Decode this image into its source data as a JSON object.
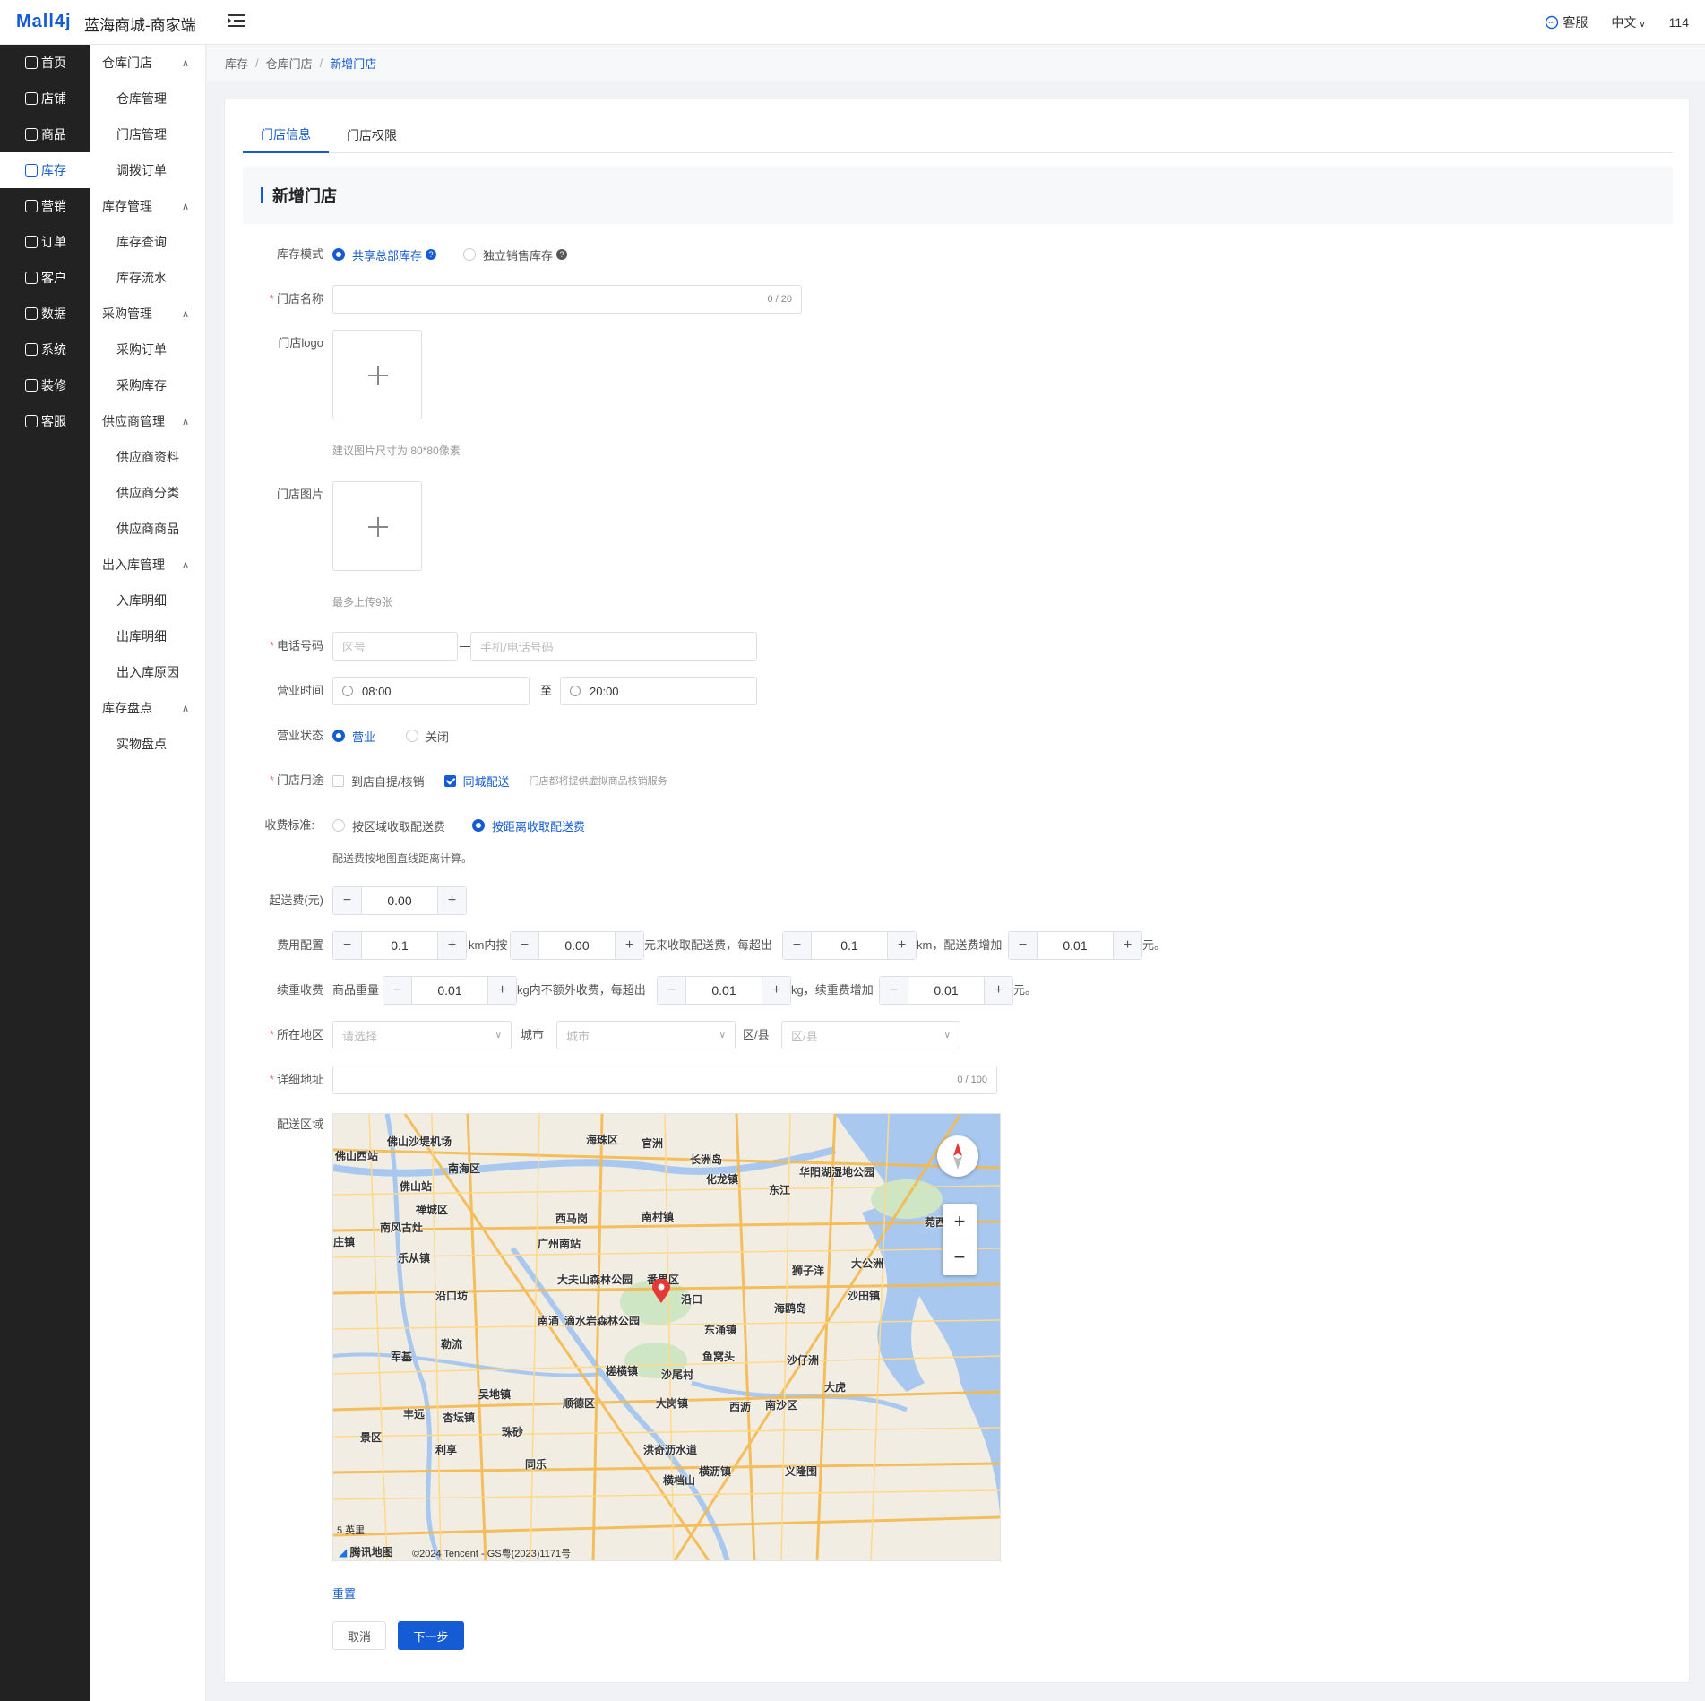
{
  "header": {
    "logo": "Mall4j",
    "store_name": "蓝海商城-商家端",
    "service": "客服",
    "language": "中文",
    "user": "114"
  },
  "nav": [
    {
      "label": "首页",
      "icon": "home-icon"
    },
    {
      "label": "店铺",
      "icon": "store-icon"
    },
    {
      "label": "商品",
      "icon": "product-icon"
    },
    {
      "label": "库存",
      "icon": "inventory-icon",
      "active": true
    },
    {
      "label": "营销",
      "icon": "gift-icon"
    },
    {
      "label": "订单",
      "icon": "order-icon"
    },
    {
      "label": "客户",
      "icon": "customer-icon"
    },
    {
      "label": "数据",
      "icon": "data-icon"
    },
    {
      "label": "系统",
      "icon": "settings-icon"
    },
    {
      "label": "装修",
      "icon": "decorate-icon"
    },
    {
      "label": "客服",
      "icon": "chat-icon"
    }
  ],
  "subnav": {
    "groups": [
      {
        "title": "仓库门店",
        "items": [
          "仓库管理",
          "门店管理",
          "调拨订单"
        ]
      },
      {
        "title": "库存管理",
        "items": [
          "库存查询",
          "库存流水"
        ]
      },
      {
        "title": "采购管理",
        "items": [
          "采购订单",
          "采购库存"
        ]
      },
      {
        "title": "供应商管理",
        "items": [
          "供应商资料",
          "供应商分类",
          "供应商商品"
        ]
      },
      {
        "title": "出入库管理",
        "items": [
          "入库明细",
          "出库明细",
          "出入库原因"
        ]
      },
      {
        "title": "库存盘点",
        "items": [
          "实物盘点"
        ]
      }
    ]
  },
  "breadcrumb": [
    "库存",
    "仓库门店",
    "新增门店"
  ],
  "tabs": [
    "门店信息",
    "门店权限"
  ],
  "section_title": "新增门店",
  "form": {
    "stock_mode": {
      "label": "库存模式",
      "options": [
        "共享总部库存",
        "独立销售库存"
      ],
      "selected": 0
    },
    "store_name": {
      "label": "门店名称",
      "counter": "0 / 20"
    },
    "store_logo": {
      "label": "门店logo",
      "hint": "建议图片尺寸为 80*80像素"
    },
    "store_images": {
      "label": "门店图片",
      "hint": "最多上传9张"
    },
    "phone": {
      "label": "电话号码",
      "area_placeholder": "区号",
      "dash": "—",
      "number_placeholder": "手机/电话号码"
    },
    "hours": {
      "label": "营业时间",
      "start": "08:00",
      "to": "至",
      "end": "20:00"
    },
    "status": {
      "label": "营业状态",
      "options": [
        "营业",
        "关闭"
      ],
      "selected": 0
    },
    "usage": {
      "label": "门店用途",
      "options": [
        "到店自提/核销",
        "同城配送"
      ],
      "checked": [
        false,
        true
      ],
      "note": "门店都将提供虚拟商品核销服务"
    },
    "fee_standard": {
      "label": "收费标准:",
      "options": [
        "按区域收取配送费",
        "按距离收取配送费"
      ],
      "selected": 1,
      "hint": "配送费按地图直线距离计算。"
    },
    "min_fee": {
      "label": "起送费(元)",
      "value": "0.00"
    },
    "fee_config": {
      "label": "费用配置",
      "v1": "0.1",
      "t1": "km内按",
      "v2": "0.00",
      "t2": "元来收取配送费，每超出",
      "v3": "0.1",
      "t3": "km，配送费增加",
      "v4": "0.01",
      "t4": "元。"
    },
    "weight_fee": {
      "label": "续重收费",
      "t0": "商品重量",
      "v1": "0.01",
      "t1": "kg内不额外收费，每超出",
      "v2": "0.01",
      "t2": "kg，续重费增加",
      "v3": "0.01",
      "t3": "元。"
    },
    "region": {
      "label": "所在地区",
      "province_placeholder": "请选择",
      "city_label": "城市",
      "city_placeholder": "城市",
      "district_label": "区/县",
      "district_placeholder": "区/县"
    },
    "address": {
      "label": "详细地址",
      "counter": "0 / 100"
    },
    "delivery_area": {
      "label": "配送区域"
    }
  },
  "map": {
    "labels": [
      "海珠区",
      "官洲",
      "长洲岛",
      "佛山沙堤机场",
      "佛山西站",
      "南海区",
      "化龙镇",
      "华阳湖湿地公园",
      "东江",
      "佛山站",
      "禅城区",
      "西马岗",
      "南村镇",
      "南风古灶",
      "广州南站",
      "庄镇",
      "乐从镇",
      "大夫山森林公园",
      "番禺区",
      "狮子洋",
      "大公洲",
      "沙田镇",
      "沿口坊",
      "沿口",
      "海鸥岛",
      "南涌",
      "滴水岩森林公园",
      "东涌镇",
      "勒流",
      "鱼窝头",
      "军基",
      "槎横镇",
      "沙尾村",
      "沙仔洲",
      "大虎",
      "吴地镇",
      "顺德区",
      "大岗镇",
      "西沥",
      "南沙区",
      "丰远",
      "杏坛镇",
      "珠砂",
      "景区",
      "利享",
      "洪奇沥水道",
      "同乐",
      "横沥镇",
      "义隆围",
      "横档山",
      "菀西"
    ],
    "attribution": "©2024 Tencent - GS粤(2023)1171号",
    "brand": "腾讯地图",
    "scale": "5 英里"
  },
  "actions": {
    "reset": "重置",
    "cancel": "取消",
    "next": "下一步"
  },
  "colors": {
    "primary": "#155bd4",
    "nav_bg": "#222222",
    "required": "#f56c6c"
  }
}
